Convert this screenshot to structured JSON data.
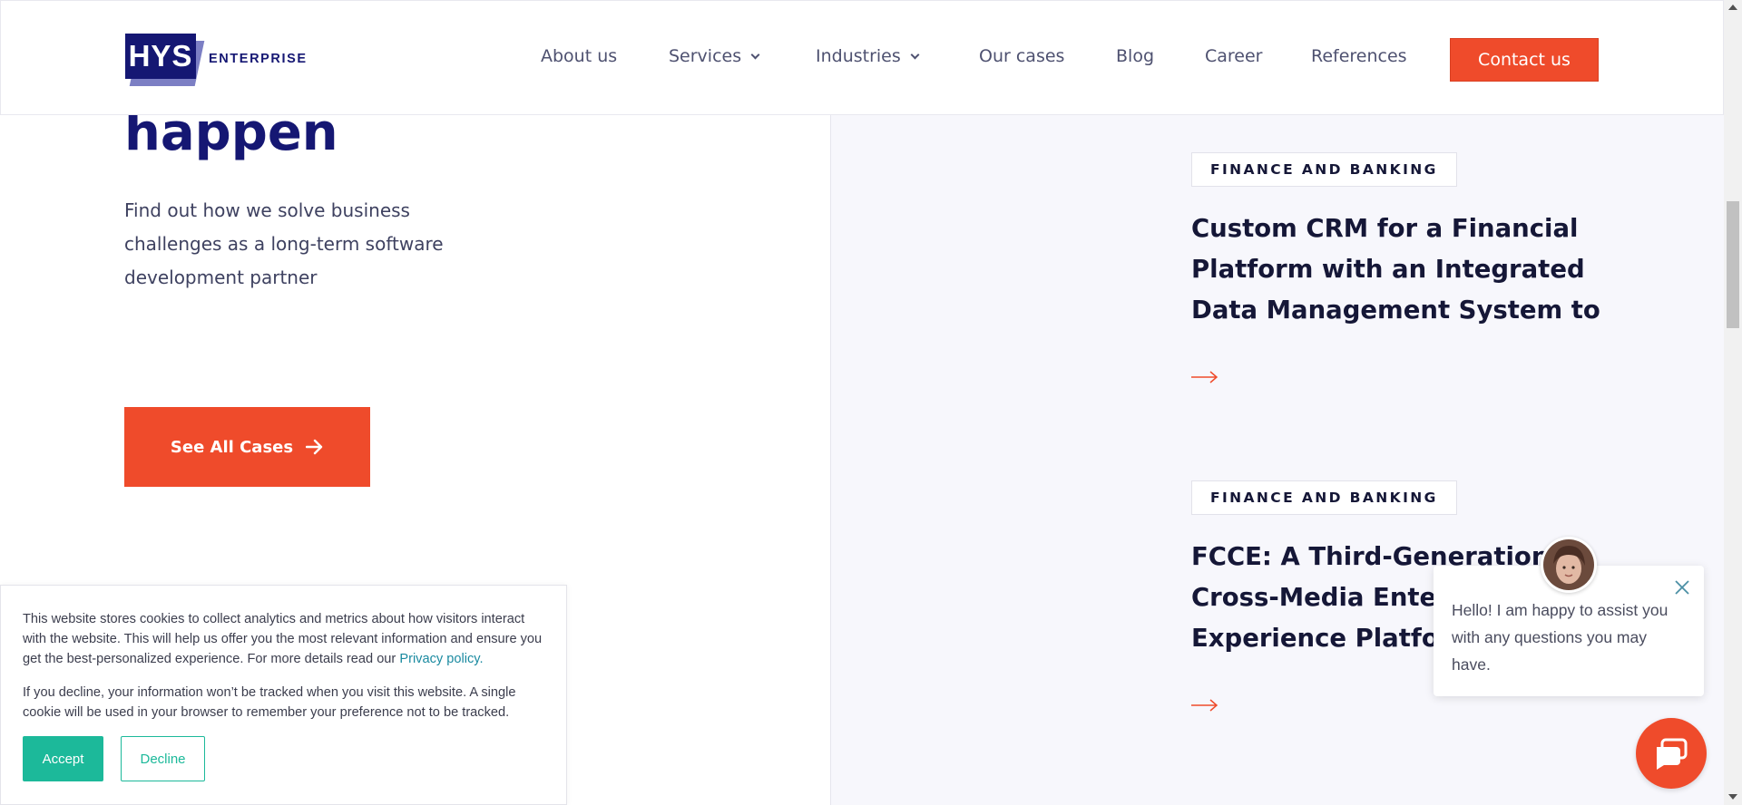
{
  "header": {
    "logo_mark": "HYS",
    "logo_text": "ENTERPRISE",
    "nav": [
      {
        "label": "About us"
      },
      {
        "label": "Services"
      },
      {
        "label": "Industries"
      },
      {
        "label": "Our cases"
      },
      {
        "label": "Blog"
      },
      {
        "label": "Career"
      },
      {
        "label": "References"
      }
    ],
    "contact_label": "Contact us"
  },
  "hero": {
    "title": "happen",
    "subtitle": "Find out how we solve business challenges as a long-term software development partner",
    "cta_label": "See All Cases",
    "cta_icon": "arrow-right-icon"
  },
  "cases": [
    {
      "tag": "FINANCE AND BANKING",
      "title_lines": [
        "Custom CRM for a Financial",
        "Platform with an Integrated",
        "Data Management System to..."
      ],
      "icon": "arrow-right-icon"
    },
    {
      "tag": "FINANCE AND BANKING",
      "title_lines": [
        "FCCE: A Third-Generation",
        "Cross-Media Entertainment",
        "Experience Platform"
      ],
      "icon": "arrow-right-icon"
    }
  ],
  "cookie": {
    "text1": "This website stores cookies to collect analytics and metrics about how visitors interact with the website. This will help us offer you the most relevant information and ensure you get the best-personalized experience. For more details read our ",
    "link": "Privacy policy.",
    "text2": "If you decline, your information won’t be tracked when you visit this website. A single cookie will be used in your browser to remember your preference not to be tracked.",
    "accept": "Accept",
    "decline": "Decline"
  },
  "chat": {
    "message": "Hello! I am happy to assist you with any questions you may have.",
    "close_icon": "close-icon",
    "launcher_icon": "chat-bubble-icon"
  },
  "colors": {
    "brand_navy": "#151773",
    "accent_orange": "#ef4b2b",
    "accept_teal": "#1cb99a",
    "panel_bg": "#f7f7fc"
  }
}
